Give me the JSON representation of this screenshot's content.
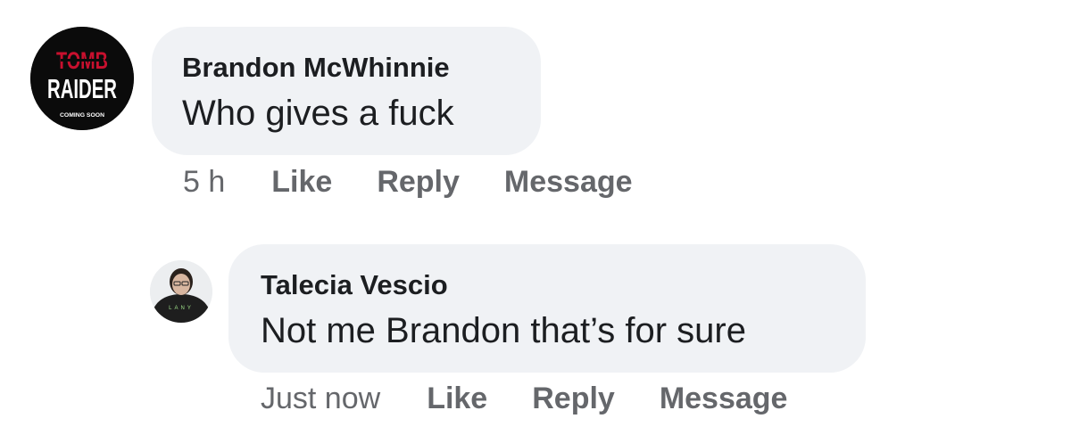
{
  "comments": [
    {
      "avatar": {
        "icon": "tomb-raider-logo-icon",
        "logo_line1": "TOMB",
        "logo_line2": "RAIDER",
        "logo_line3": "COMING SOON",
        "accent": "#c8102e"
      },
      "author": "Brandon McWhinnie",
      "text": "Who gives a fuck",
      "time": "5 h",
      "like_label": "Like",
      "reply_label": "Reply",
      "message_label": "Message"
    },
    {
      "avatar": {
        "icon": "person-photo-icon",
        "shirt_text": "LANY"
      },
      "author": "Talecia Vescio",
      "text": "Not me Brandon that’s for sure",
      "time": "Just now",
      "like_label": "Like",
      "reply_label": "Reply",
      "message_label": "Message"
    }
  ],
  "colors": {
    "bubble": "#f0f2f5",
    "text": "#1c1e21",
    "secondary": "#65676b"
  }
}
